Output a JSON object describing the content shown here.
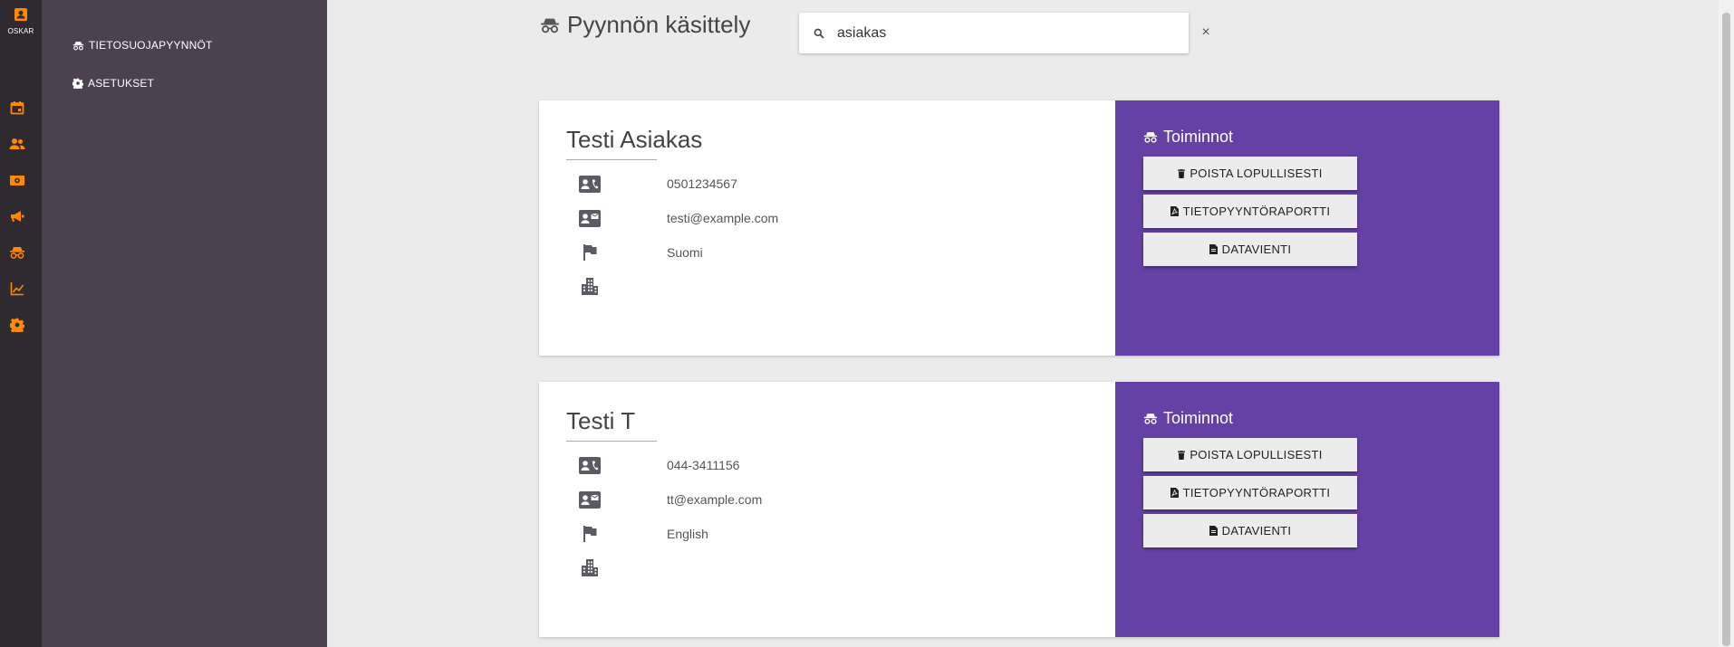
{
  "rail": {
    "user_label": "OSKAR",
    "icons": [
      "calendar-icon",
      "people-icon",
      "money-icon",
      "megaphone-icon",
      "incognito-icon",
      "chart-icon",
      "gear-icon"
    ],
    "accent": "#ff8a00"
  },
  "sidebar": {
    "items": [
      {
        "label": "TIETOSUOJAPYYNNÖT",
        "icon": "incognito-icon"
      },
      {
        "label": "ASETUKSET",
        "icon": "gear-icon"
      }
    ]
  },
  "header": {
    "title": "Pyynnön käsittely",
    "search_value": "asiakas",
    "clear_label": "×"
  },
  "cards": [
    {
      "name": "Testi Asiakas",
      "phone": "0501234567",
      "email": "testi@example.com",
      "language": "Suomi",
      "company": "",
      "actions_title": "Toiminnot",
      "actions": [
        "POISTA LOPULLISESTI",
        "TIETOPYYNTÖRAPORTTI",
        "DATAVIENTI"
      ]
    },
    {
      "name": "Testi T",
      "phone": "044-3411156",
      "email": "tt@example.com",
      "language": "English",
      "company": "",
      "actions_title": "Toiminnot",
      "actions": [
        "POISTA LOPULLISESTI",
        "TIETOPYYNTÖRAPORTTI",
        "DATAVIENTI"
      ]
    }
  ],
  "colors": {
    "rail_bg": "#2f2a30",
    "sidebar_bg": "#4b4150",
    "actions_bg": "#6441a4",
    "accent": "#ff8a00"
  }
}
